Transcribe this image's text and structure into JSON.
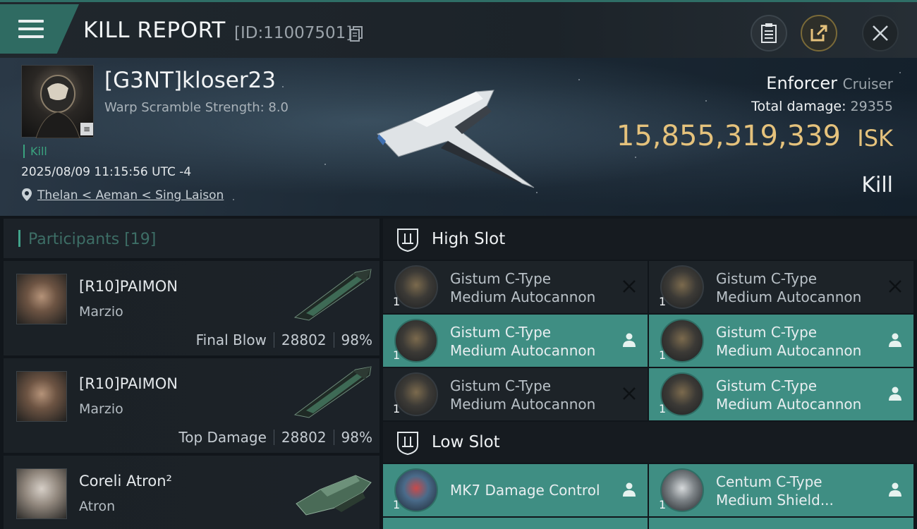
{
  "header": {
    "title": "KILL REPORT",
    "report_id": "[ID:11007501]"
  },
  "victim": {
    "name": "[G3NT]kloser23",
    "warp_scramble": "Warp Scramble Strength: 8.0",
    "tag": "Kill",
    "timestamp": "2025/08/09 11:15:56 UTC -4",
    "location": "Thelan < Aeman < Sing Laison",
    "ship_name": "Enforcer",
    "ship_class": "Cruiser",
    "total_damage_label": "Total damage:",
    "total_damage_value": "29355",
    "isk_value": "15,855,319,339",
    "isk_unit": "ISK",
    "result": "Kill"
  },
  "participants": {
    "title": "Participants [19]",
    "items": [
      {
        "name": "[R10]PAIMON",
        "corp": "Marzio",
        "role": "Final Blow",
        "damage": "28802",
        "percent": "98%"
      },
      {
        "name": "[R10]PAIMON",
        "corp": "Marzio",
        "role": "Top Damage",
        "damage": "28802",
        "percent": "98%"
      },
      {
        "name": "Coreli Atron²",
        "corp": "Atron",
        "role": "",
        "damage": "",
        "percent": ""
      }
    ]
  },
  "fitting": {
    "high_slot_label": "High Slot",
    "low_slot_label": "Low Slot",
    "high_slot": [
      {
        "line1": "Gistum C-Type",
        "line2": "Medium Autocannon",
        "qty": "1",
        "status": "destroyed"
      },
      {
        "line1": "Gistum C-Type",
        "line2": "Medium Autocannon",
        "qty": "1",
        "status": "destroyed"
      },
      {
        "line1": "Gistum C-Type",
        "line2": "Medium Autocannon",
        "qty": "1",
        "status": "dropped"
      },
      {
        "line1": "Gistum C-Type",
        "line2": "Medium Autocannon",
        "qty": "1",
        "status": "dropped"
      },
      {
        "line1": "Gistum C-Type",
        "line2": "Medium Autocannon",
        "qty": "1",
        "status": "destroyed"
      },
      {
        "line1": "Gistum C-Type",
        "line2": "Medium Autocannon",
        "qty": "1",
        "status": "dropped"
      }
    ],
    "low_slot": [
      {
        "line1": "MK7 Damage Control",
        "line2": "",
        "qty": "1",
        "status": "dropped"
      },
      {
        "line1": "Centum C-Type",
        "line2": "Medium Shield...",
        "qty": "1",
        "status": "dropped"
      }
    ]
  },
  "colors": {
    "accent": "#3f8e83",
    "isk": "#e5c27c",
    "kill_tag": "#3aa37f"
  }
}
